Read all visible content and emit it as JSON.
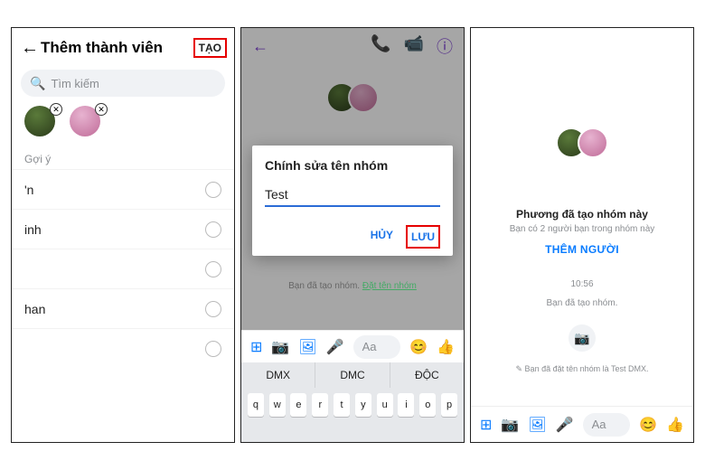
{
  "screen1": {
    "title": "Thêm thành viên",
    "create_label": "TẠO",
    "search_placeholder": "Tìm kiếm",
    "section_label": "Gợi ý",
    "suggestions": [
      "'n",
      "inh",
      "",
      "han",
      ""
    ]
  },
  "screen2": {
    "dialog_title": "Chính sửa tên nhóm",
    "input_value": "Test",
    "cancel_label": "HỦY",
    "save_label": "LƯU",
    "hint_prefix": "Bạn đã tạo nhóm.",
    "hint_link": "Đặt tên nhóm",
    "composer_placeholder": "Aa",
    "keyboard_suggestions": [
      "DMX",
      "DMC",
      "ĐỘC"
    ],
    "keyboard_row": [
      "q",
      "w",
      "e",
      "r",
      "t",
      "y",
      "u",
      "i",
      "o",
      "p"
    ]
  },
  "screen3": {
    "msg_created": "Phương đã tạo nhóm này",
    "msg_friends": "Bạn có 2 người bạn trong nhóm này",
    "add_label": "THÊM NGƯỜI",
    "time": "10:56",
    "created_short": "Bạn đã tạo nhóm.",
    "named_hint": "✎ Bạn đã đặt tên nhóm là Test DMX.",
    "composer_placeholder": "Aa"
  },
  "icons": {
    "apps": "⊞",
    "camera": "📷",
    "gallery": "🖼",
    "mic": "🎤",
    "emoji": "😊",
    "like": "👍",
    "call": "📞",
    "video": "📹",
    "info": "ⓘ",
    "cam_solid": "●"
  }
}
